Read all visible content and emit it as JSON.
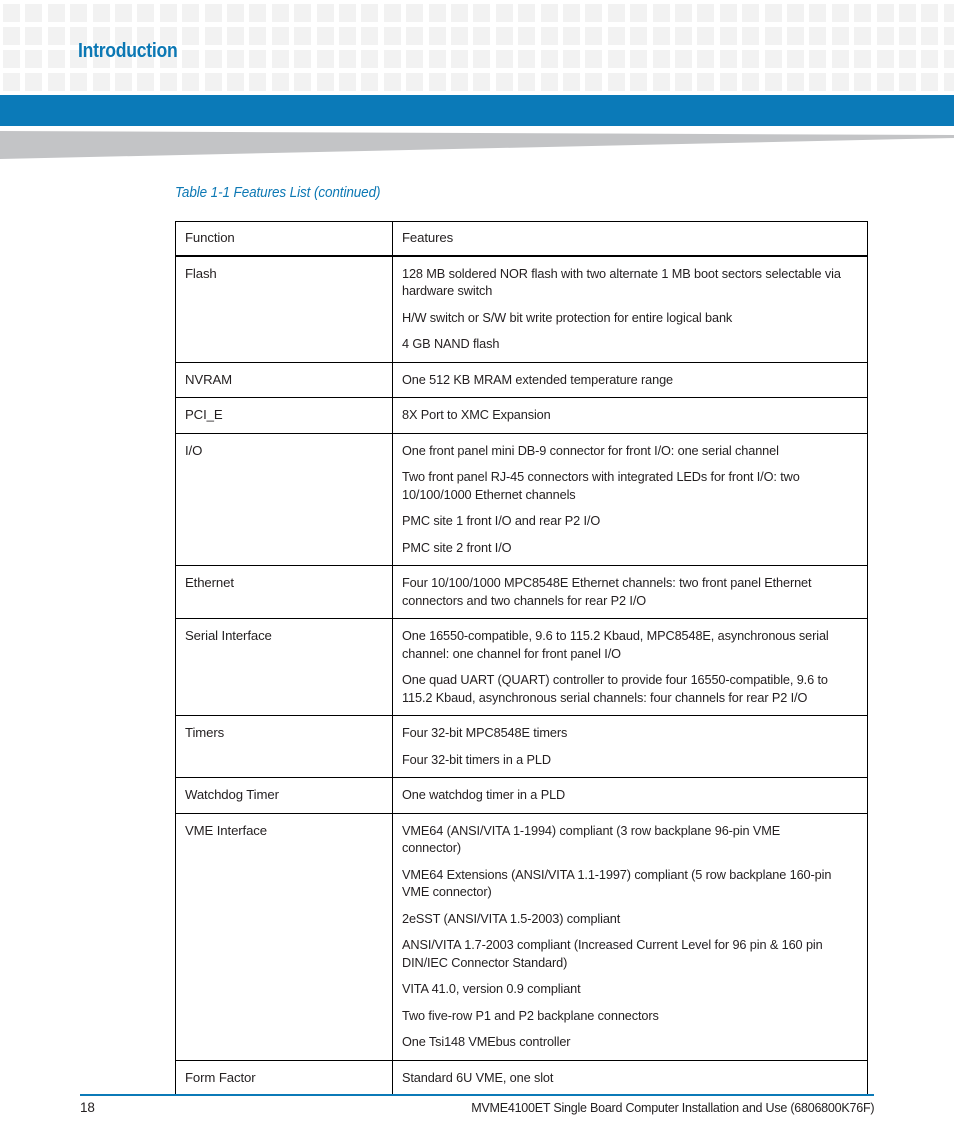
{
  "header": {
    "title": "Introduction",
    "accent_color": "#0b7ab8",
    "pattern_color": "#f2f2f2",
    "wedge_color": "#c3c4c6"
  },
  "table": {
    "caption": "Table 1-1 Features List (continued)",
    "caption_color": "#0c78b4",
    "columns": [
      "Function",
      "Features"
    ],
    "rows": [
      {
        "function": "Flash",
        "features": [
          "128 MB soldered NOR flash with two alternate 1 MB boot sectors selectable via hardware switch",
          "H/W switch or S/W bit write protection for entire logical bank",
          "4 GB NAND flash"
        ]
      },
      {
        "function": "NVRAM",
        "features": [
          "One 512 KB MRAM extended temperature range"
        ]
      },
      {
        "function": "PCI_E",
        "features": [
          "8X Port to XMC Expansion"
        ]
      },
      {
        "function": "I/O",
        "features": [
          "One front panel mini DB-9 connector for front I/O: one serial channel",
          "Two front panel RJ-45 connectors with integrated LEDs for front I/O: two 10/100/1000 Ethernet channels",
          "PMC site 1 front I/O and rear P2 I/O",
          "PMC site 2 front I/O"
        ]
      },
      {
        "function": "Ethernet",
        "features": [
          "Four 10/100/1000 MPC8548E Ethernet channels: two front panel Ethernet connectors and two channels for rear P2 I/O"
        ]
      },
      {
        "function": "Serial Interface",
        "features": [
          "One 16550-compatible, 9.6 to 115.2 Kbaud, MPC8548E, asynchronous serial channel: one channel for front panel I/O",
          "One quad UART (QUART) controller to provide four 16550-compatible, 9.6 to 115.2 Kbaud, asynchronous serial channels: four channels for rear P2 I/O"
        ]
      },
      {
        "function": "Timers",
        "features": [
          "Four 32-bit MPC8548E timers",
          "Four 32-bit timers in a PLD"
        ]
      },
      {
        "function": "Watchdog Timer",
        "features": [
          "One watchdog timer in a PLD"
        ]
      },
      {
        "function": "VME Interface",
        "features": [
          "VME64 (ANSI/VITA 1-1994) compliant (3 row backplane 96-pin VME connector)",
          "VME64 Extensions (ANSI/VITA 1.1-1997) compliant (5 row backplane 160-pin VME connector)",
          "2eSST (ANSI/VITA 1.5-2003) compliant",
          "ANSI/VITA 1.7-2003 compliant (Increased Current Level for 96 pin & 160 pin DIN/IEC Connector Standard)",
          "VITA 41.0, version 0.9 compliant",
          "Two five-row P1 and P2 backplane connectors",
          "One Tsi148 VMEbus controller"
        ]
      },
      {
        "function": "Form Factor",
        "features": [
          "Standard 6U VME, one slot"
        ]
      }
    ]
  },
  "footer": {
    "page_number": "18",
    "document_title": "MVME4100ET Single Board Computer Installation and Use (6806800K76F)",
    "rule_color": "#0b7ab8"
  }
}
